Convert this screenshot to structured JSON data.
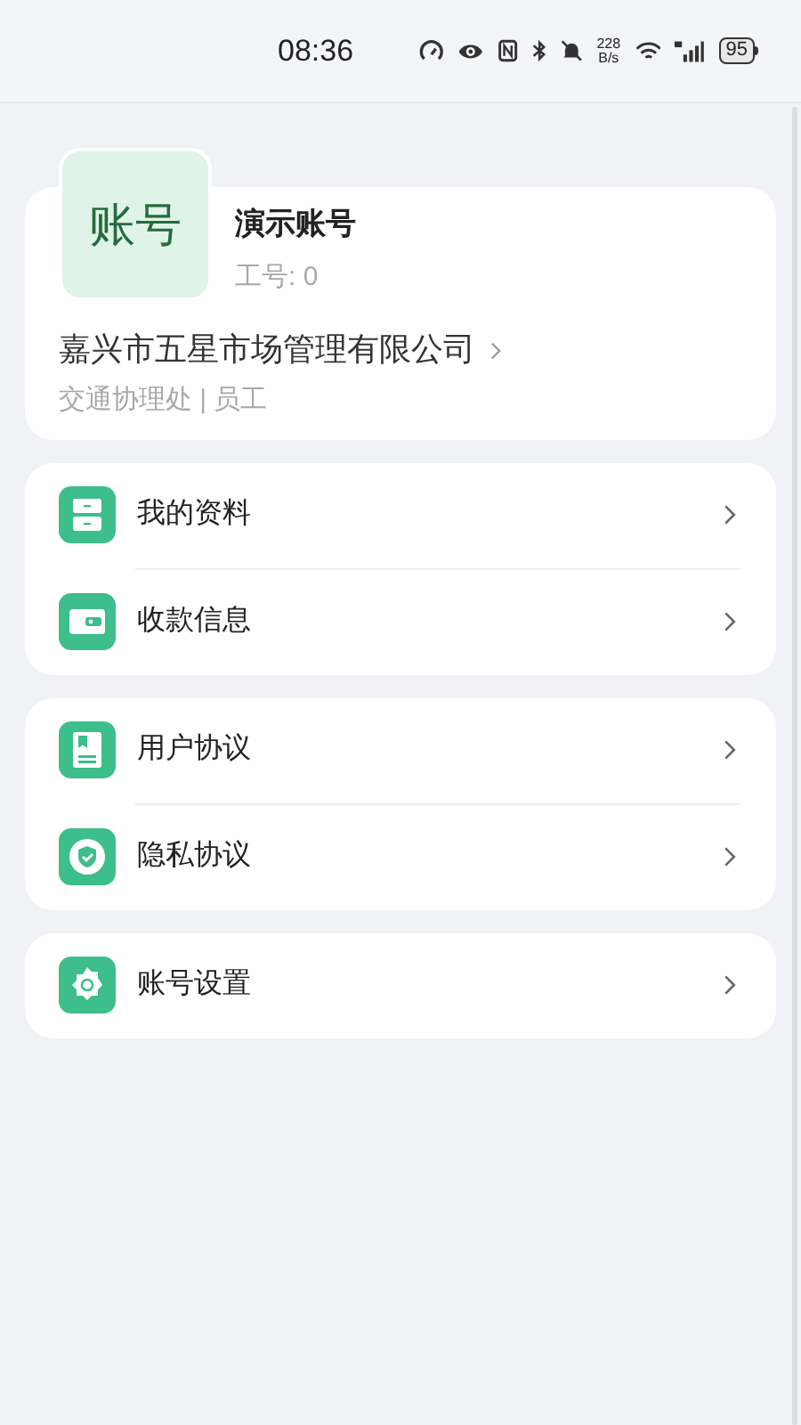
{
  "status_bar": {
    "time": "08:36",
    "speed_value": "228",
    "speed_unit": "B/s",
    "battery": "95"
  },
  "profile": {
    "avatar_text": "账号",
    "name": "演示账号",
    "employee_id": "工号: 0",
    "company": "嘉兴市五星市场管理有限公司",
    "department": "交通协理处 | 员工"
  },
  "menu_groups": [
    [
      {
        "label": "我的资料",
        "kind": "drawer"
      },
      {
        "label": "收款信息",
        "kind": "wallet"
      }
    ],
    [
      {
        "label": "用户协议",
        "kind": "book"
      },
      {
        "label": "隐私协议",
        "kind": "shield"
      }
    ],
    [
      {
        "label": "账号设置",
        "kind": "gear"
      }
    ]
  ]
}
